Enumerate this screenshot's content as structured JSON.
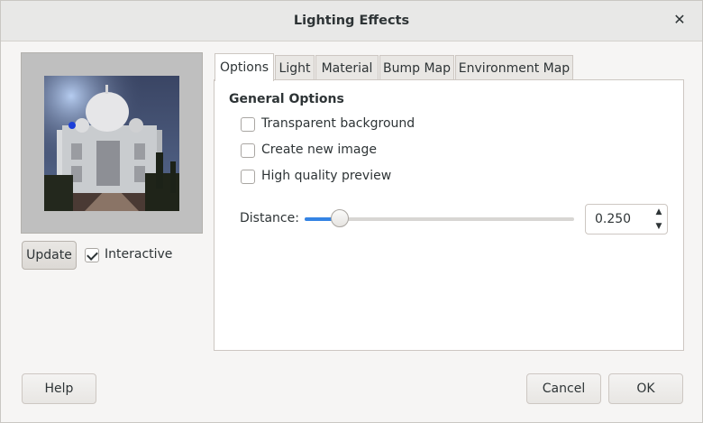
{
  "window": {
    "title": "Lighting Effects",
    "close_glyph": "✕"
  },
  "preview": {
    "image": "taj-mahal-preview",
    "light_marker_color": "#1c3fd8"
  },
  "controls": {
    "update_label": "Update",
    "interactive_label": "Interactive",
    "interactive_checked": true
  },
  "tabs": [
    {
      "label": "Options",
      "active": true
    },
    {
      "label": "Light",
      "active": false
    },
    {
      "label": "Material",
      "active": false
    },
    {
      "label": "Bump Map",
      "active": false
    },
    {
      "label": "Environment Map",
      "active": false
    }
  ],
  "options": {
    "section_title": "General Options",
    "checkboxes": [
      {
        "label": "Transparent background",
        "checked": false
      },
      {
        "label": "Create new image",
        "checked": false
      },
      {
        "label": "High quality preview",
        "checked": false
      }
    ],
    "distance": {
      "label": "Distance:",
      "value": "0.250",
      "level": 0.13,
      "up_glyph": "▲",
      "down_glyph": "▼"
    }
  },
  "footer": {
    "help_label": "Help",
    "cancel_label": "Cancel",
    "ok_label": "OK"
  },
  "colors": {
    "accent": "#3584e4",
    "dialog_bg": "#f6f5f4"
  }
}
